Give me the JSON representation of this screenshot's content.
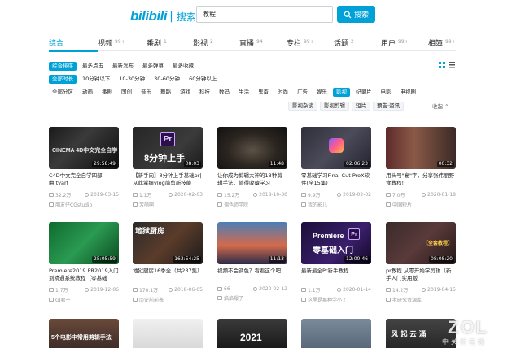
{
  "header": {
    "logo": "bilibili",
    "logo_sub": "搜索",
    "search_value": "教程",
    "search_button": "搜索"
  },
  "tabs": [
    {
      "label": "综合",
      "count": ""
    },
    {
      "label": "视频",
      "count": "99+"
    },
    {
      "label": "番剧",
      "count": "1"
    },
    {
      "label": "影视",
      "count": "2"
    },
    {
      "label": "直播",
      "count": "94"
    },
    {
      "label": "专栏",
      "count": "99+"
    },
    {
      "label": "话题",
      "count": "2"
    },
    {
      "label": "用户",
      "count": "99+"
    },
    {
      "label": "相簿",
      "count": "99+"
    }
  ],
  "filters": {
    "order": [
      "综合排序",
      "最多点击",
      "最新发布",
      "最多弹幕",
      "最多收藏"
    ],
    "duration": [
      "全部时长",
      "10分钟以下",
      "10-30分钟",
      "30-60分钟",
      "60分钟以上"
    ],
    "zones": [
      "全部分区",
      "动画",
      "番剧",
      "国创",
      "音乐",
      "舞蹈",
      "游戏",
      "科技",
      "数码",
      "生活",
      "鬼畜",
      "时尚",
      "广告",
      "娱乐",
      "影视",
      "纪录片",
      "电影",
      "电视剧"
    ],
    "subzones": [
      "影视杂谈",
      "影视剪辑",
      "短片",
      "预告·资讯"
    ],
    "collapse_label": "收起"
  },
  "videos": [
    {
      "title": "C4D中文完全自学四部曲.tvart",
      "duration": "29:58:49",
      "views": "32.2万",
      "date": "2019-03-15",
      "uploader": "朋友仔CGstudio",
      "overlay": "CINEMA 4D中文完全自学"
    },
    {
      "title": "【新手向】8分钟上手基础pr|从此掌握vlog简剪新技能",
      "duration": "08:03",
      "views": "1.1万",
      "date": "2020-02-03",
      "uploader": "芳萌啊",
      "overlay": "8分钟上手"
    },
    {
      "title": "让你成为剪辑大神的13种剪辑手法，值得收藏学习",
      "duration": "11:48",
      "views": "15.2万",
      "date": "2018-10-30",
      "uploader": "调色师学院",
      "overlay": ""
    },
    {
      "title": "零基础学习Final Cut ProX软件(全15集)",
      "duration": "02:06:23",
      "views": "9.9万",
      "date": "2019-02-02",
      "uploader": "我的影儿",
      "overlay": ""
    },
    {
      "title": "用头号\"宴\"字，分享张伟丽野食教程!",
      "duration": "00:32",
      "views": "7.0万",
      "date": "2020-01-18",
      "uploader": "中国短片",
      "overlay": ""
    },
    {
      "title": "Premiere2019 PR2019入门到精通系统教程（零基础",
      "duration": "25:05:59",
      "views": "1.7万",
      "date": "2019-12-06",
      "uploader": "GJ君子",
      "overlay": ""
    },
    {
      "title": "地狱厨房16季全（共237集）",
      "duration": "163:54:25",
      "views": "170.1万",
      "date": "2018-06-05",
      "uploader": "历史前前表",
      "overlay": "地狱厨房"
    },
    {
      "title": "视频不会调色？看看这个吧!",
      "duration": "11:13",
      "views": "66",
      "date": "2020-02-12",
      "uploader": "焰焰爆子",
      "overlay": ""
    },
    {
      "title": "最新最全Pr新手教程",
      "duration": "12:00:46",
      "views": "1.1万",
      "date": "2020-01-14",
      "uploader": "这里是那种学小丫",
      "overlay": "零基础入门"
    },
    {
      "title": "pr教程 从零开始学剪辑（新手入门实用版",
      "duration": "08:08:20",
      "views": "14.2万",
      "date": "2019-04-15",
      "uploader": "老研究资源库",
      "overlay": "【全套教程】"
    },
    {
      "title": "",
      "duration": "",
      "views": "",
      "date": "",
      "uploader": "",
      "overlay": "5个电影中常用剪辑手法"
    },
    {
      "title": "",
      "duration": "",
      "views": "",
      "date": "",
      "uploader": "",
      "overlay": ""
    },
    {
      "title": "",
      "duration": "",
      "views": "",
      "date": "",
      "uploader": "",
      "overlay": "2021"
    },
    {
      "title": "",
      "duration": "",
      "views": "",
      "date": "",
      "uploader": "",
      "overlay": ""
    },
    {
      "title": "",
      "duration": "",
      "views": "",
      "date": "",
      "uploader": "",
      "overlay": "风 起 云 涌"
    }
  ],
  "watermark": {
    "main": "ZOL",
    "sub": "中关村在线"
  },
  "colors": {
    "accent": "#00a1d6"
  }
}
